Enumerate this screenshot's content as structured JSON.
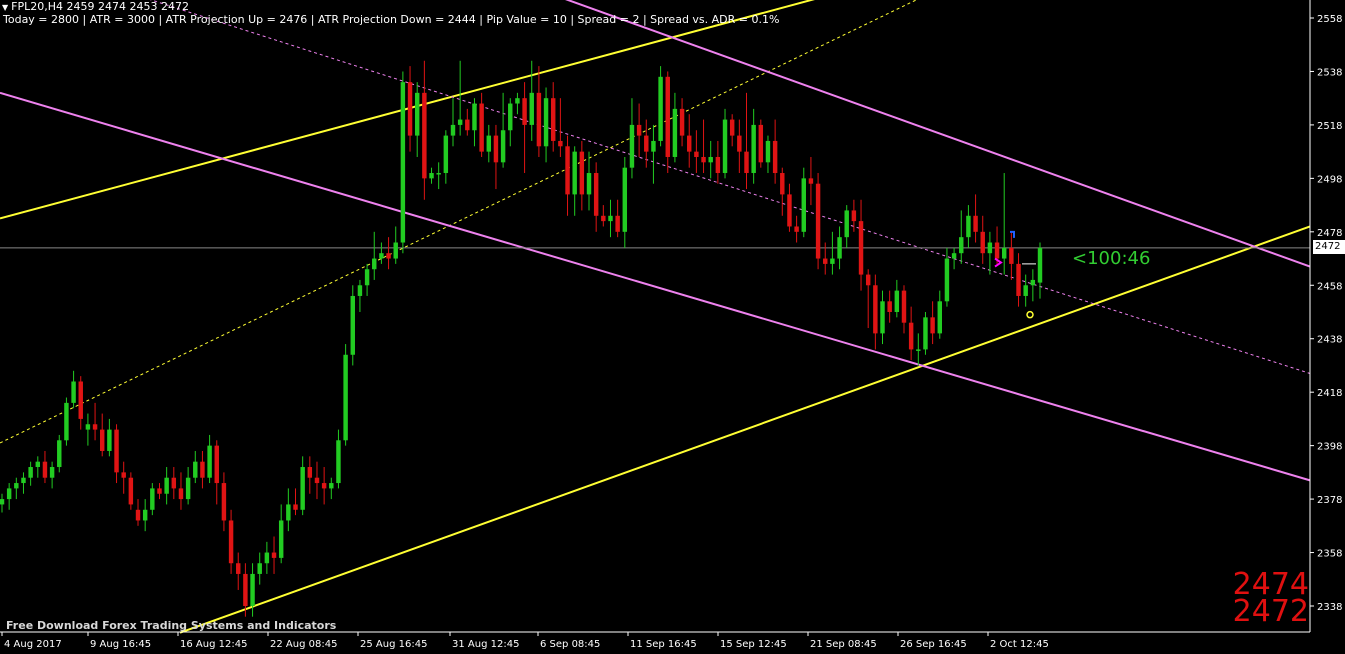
{
  "header": {
    "symbol_line": "FPL20,H4  2459 2474 2453 2472",
    "info_line": "Today = 2800   |   ATR = 3000   |   ATR Projection Up = 2476   |   ATR Projection Down = 2444   |   Pip Value = 10   |   Spread = 2   |   Spread vs. ADR = 0.1%"
  },
  "watermark": "Free Download Forex Trading Systems and Indicators",
  "countdown": "<100:46",
  "big_prices": {
    "high": "2474",
    "current": "2472"
  },
  "current_price_tag": "2472",
  "colors": {
    "background": "#000000",
    "bull": "#22cc22",
    "bear": "#e01414",
    "yellow_channel": "#ffff33",
    "pink_channel": "#ee82ee",
    "axis_text": "#ffffff",
    "countdown": "#32cd32"
  },
  "chart_data": {
    "type": "candlestick",
    "timeframe": "H4",
    "symbol": "FPL20",
    "ylim": [
      2328,
      2564
    ],
    "y_ticks": [
      2558,
      2538,
      2518,
      2498,
      2478,
      2458,
      2438,
      2418,
      2398,
      2378,
      2358,
      2338
    ],
    "x_ticks": [
      "4 Aug 2017",
      "9 Aug 16:45",
      "16 Aug 12:45",
      "22 Aug 08:45",
      "25 Aug 16:45",
      "31 Aug 12:45",
      "6 Sep 08:45",
      "11 Sep 16:45",
      "15 Sep 12:45",
      "21 Sep 08:45",
      "26 Sep 16:45",
      "2 Oct 12:45"
    ],
    "current_price": 2472,
    "candles": [
      [
        2376,
        2380,
        2373,
        2378
      ],
      [
        2378,
        2384,
        2374,
        2382
      ],
      [
        2382,
        2386,
        2378,
        2384
      ],
      [
        2384,
        2388,
        2380,
        2386
      ],
      [
        2386,
        2392,
        2383,
        2390
      ],
      [
        2390,
        2394,
        2386,
        2392
      ],
      [
        2392,
        2396,
        2384,
        2386
      ],
      [
        2386,
        2392,
        2382,
        2390
      ],
      [
        2390,
        2402,
        2388,
        2400
      ],
      [
        2400,
        2416,
        2398,
        2414
      ],
      [
        2414,
        2426,
        2412,
        2422
      ],
      [
        2422,
        2424,
        2404,
        2408
      ],
      [
        2404,
        2410,
        2398,
        2406
      ],
      [
        2406,
        2414,
        2400,
        2404
      ],
      [
        2404,
        2410,
        2394,
        2396
      ],
      [
        2396,
        2408,
        2394,
        2404
      ],
      [
        2404,
        2406,
        2384,
        2388
      ],
      [
        2388,
        2392,
        2380,
        2386
      ],
      [
        2386,
        2388,
        2374,
        2376
      ],
      [
        2374,
        2378,
        2368,
        2370
      ],
      [
        2370,
        2378,
        2366,
        2374
      ],
      [
        2374,
        2384,
        2372,
        2382
      ],
      [
        2382,
        2384,
        2378,
        2380
      ],
      [
        2380,
        2390,
        2376,
        2386
      ],
      [
        2386,
        2390,
        2378,
        2382
      ],
      [
        2382,
        2388,
        2374,
        2378
      ],
      [
        2378,
        2390,
        2376,
        2386
      ],
      [
        2386,
        2396,
        2384,
        2392
      ],
      [
        2392,
        2396,
        2382,
        2386
      ],
      [
        2386,
        2402,
        2384,
        2398
      ],
      [
        2398,
        2400,
        2376,
        2384
      ],
      [
        2384,
        2388,
        2366,
        2370
      ],
      [
        2370,
        2374,
        2350,
        2354
      ],
      [
        2354,
        2358,
        2344,
        2350
      ],
      [
        2350,
        2354,
        2334,
        2338
      ],
      [
        2338,
        2354,
        2334,
        2350
      ],
      [
        2350,
        2358,
        2346,
        2354
      ],
      [
        2354,
        2362,
        2350,
        2358
      ],
      [
        2358,
        2364,
        2350,
        2356
      ],
      [
        2356,
        2376,
        2354,
        2370
      ],
      [
        2370,
        2382,
        2366,
        2376
      ],
      [
        2376,
        2382,
        2372,
        2374
      ],
      [
        2374,
        2394,
        2372,
        2390
      ],
      [
        2390,
        2394,
        2380,
        2386
      ],
      [
        2386,
        2392,
        2378,
        2384
      ],
      [
        2384,
        2390,
        2376,
        2382
      ],
      [
        2382,
        2386,
        2378,
        2384
      ],
      [
        2384,
        2404,
        2382,
        2400
      ],
      [
        2400,
        2436,
        2398,
        2432
      ],
      [
        2432,
        2458,
        2428,
        2454
      ],
      [
        2454,
        2460,
        2448,
        2458
      ],
      [
        2458,
        2466,
        2454,
        2464
      ],
      [
        2464,
        2478,
        2460,
        2468
      ],
      [
        2468,
        2474,
        2466,
        2470
      ],
      [
        2470,
        2476,
        2464,
        2468
      ],
      [
        2468,
        2480,
        2466,
        2474
      ],
      [
        2474,
        2538,
        2470,
        2534
      ],
      [
        2534,
        2540,
        2508,
        2514
      ],
      [
        2514,
        2534,
        2506,
        2530
      ],
      [
        2530,
        2542,
        2490,
        2498
      ],
      [
        2498,
        2502,
        2496,
        2500
      ],
      [
        2500,
        2504,
        2494,
        2500
      ],
      [
        2500,
        2516,
        2496,
        2514
      ],
      [
        2514,
        2528,
        2510,
        2518
      ],
      [
        2518,
        2542,
        2514,
        2520
      ],
      [
        2520,
        2524,
        2514,
        2516
      ],
      [
        2516,
        2528,
        2510,
        2526
      ],
      [
        2526,
        2530,
        2506,
        2508
      ],
      [
        2508,
        2518,
        2504,
        2514
      ],
      [
        2514,
        2518,
        2494,
        2504
      ],
      [
        2504,
        2530,
        2502,
        2516
      ],
      [
        2516,
        2528,
        2510,
        2526
      ],
      [
        2526,
        2530,
        2522,
        2528
      ],
      [
        2528,
        2534,
        2500,
        2518
      ],
      [
        2518,
        2542,
        2512,
        2530
      ],
      [
        2530,
        2540,
        2506,
        2510
      ],
      [
        2510,
        2532,
        2504,
        2528
      ],
      [
        2528,
        2534,
        2508,
        2512
      ],
      [
        2512,
        2528,
        2506,
        2510
      ],
      [
        2510,
        2514,
        2484,
        2492
      ],
      [
        2492,
        2510,
        2484,
        2508
      ],
      [
        2508,
        2512,
        2486,
        2492
      ],
      [
        2492,
        2508,
        2486,
        2500
      ],
      [
        2500,
        2504,
        2478,
        2484
      ],
      [
        2484,
        2488,
        2480,
        2482
      ],
      [
        2482,
        2490,
        2476,
        2484
      ],
      [
        2484,
        2490,
        2476,
        2478
      ],
      [
        2478,
        2506,
        2472,
        2502
      ],
      [
        2502,
        2528,
        2498,
        2518
      ],
      [
        2518,
        2526,
        2506,
        2514
      ],
      [
        2514,
        2520,
        2502,
        2508
      ],
      [
        2508,
        2518,
        2496,
        2512
      ],
      [
        2512,
        2540,
        2510,
        2536
      ],
      [
        2536,
        2538,
        2500,
        2506
      ],
      [
        2506,
        2530,
        2504,
        2524
      ],
      [
        2524,
        2528,
        2510,
        2514
      ],
      [
        2514,
        2522,
        2502,
        2508
      ],
      [
        2508,
        2516,
        2500,
        2506
      ],
      [
        2506,
        2520,
        2500,
        2504
      ],
      [
        2504,
        2512,
        2498,
        2506
      ],
      [
        2506,
        2512,
        2496,
        2500
      ],
      [
        2500,
        2524,
        2498,
        2520
      ],
      [
        2520,
        2522,
        2510,
        2514
      ],
      [
        2514,
        2520,
        2500,
        2508
      ],
      [
        2508,
        2530,
        2494,
        2500
      ],
      [
        2500,
        2524,
        2496,
        2518
      ],
      [
        2518,
        2520,
        2502,
        2504
      ],
      [
        2504,
        2514,
        2500,
        2512
      ],
      [
        2512,
        2520,
        2496,
        2500
      ],
      [
        2500,
        2502,
        2484,
        2492
      ],
      [
        2492,
        2496,
        2478,
        2480
      ],
      [
        2480,
        2484,
        2474,
        2478
      ],
      [
        2478,
        2502,
        2476,
        2498
      ],
      [
        2498,
        2506,
        2488,
        2496
      ],
      [
        2496,
        2500,
        2464,
        2468
      ],
      [
        2468,
        2474,
        2462,
        2466
      ],
      [
        2466,
        2478,
        2462,
        2468
      ],
      [
        2468,
        2480,
        2464,
        2476
      ],
      [
        2476,
        2488,
        2472,
        2486
      ],
      [
        2486,
        2490,
        2478,
        2482
      ],
      [
        2482,
        2490,
        2456,
        2462
      ],
      [
        2462,
        2464,
        2442,
        2458
      ],
      [
        2458,
        2462,
        2434,
        2440
      ],
      [
        2440,
        2456,
        2436,
        2452
      ],
      [
        2452,
        2456,
        2444,
        2448
      ],
      [
        2448,
        2460,
        2446,
        2456
      ],
      [
        2456,
        2458,
        2440,
        2444
      ],
      [
        2444,
        2450,
        2430,
        2434
      ],
      [
        2434,
        2440,
        2428,
        2434
      ],
      [
        2434,
        2448,
        2432,
        2446
      ],
      [
        2446,
        2452,
        2436,
        2440
      ],
      [
        2440,
        2456,
        2438,
        2452
      ],
      [
        2452,
        2472,
        2450,
        2468
      ],
      [
        2468,
        2472,
        2464,
        2470
      ],
      [
        2470,
        2486,
        2466,
        2476
      ],
      [
        2476,
        2488,
        2472,
        2484
      ],
      [
        2484,
        2492,
        2474,
        2478
      ],
      [
        2478,
        2484,
        2466,
        2470
      ],
      [
        2470,
        2478,
        2462,
        2474
      ],
      [
        2474,
        2480,
        2466,
        2468
      ],
      [
        2468,
        2500,
        2462,
        2472
      ],
      [
        2472,
        2478,
        2460,
        2466
      ],
      [
        2466,
        2470,
        2450,
        2454
      ],
      [
        2454,
        2462,
        2450,
        2458
      ],
      [
        2458,
        2464,
        2452,
        2460
      ],
      [
        2459,
        2474,
        2453,
        2472
      ]
    ],
    "lines": [
      {
        "name": "yellow-upper",
        "from": {
          "x": 0,
          "y": 2483
        },
        "to": {
          "x": 1310,
          "y": 2615
        },
        "style": "solid"
      },
      {
        "name": "yellow-lower",
        "from": {
          "x": 180,
          "y": 2328
        },
        "to": {
          "x": 1310,
          "y": 2480
        },
        "style": "solid"
      },
      {
        "name": "yellow-mid",
        "from": {
          "x": 0,
          "y": 2399
        },
        "to": {
          "x": 1310,
          "y": 2636
        },
        "style": "dotted"
      },
      {
        "name": "pink-upper",
        "from": {
          "x": 380,
          "y": 2590
        },
        "to": {
          "x": 1310,
          "y": 2465
        },
        "style": "solid"
      },
      {
        "name": "pink-lower",
        "from": {
          "x": 0,
          "y": 2530
        },
        "to": {
          "x": 1310,
          "y": 2385
        },
        "style": "solid"
      },
      {
        "name": "pink-mid",
        "from": {
          "x": 0,
          "y": 2583
        },
        "to": {
          "x": 1310,
          "y": 2425
        },
        "style": "dotted"
      }
    ]
  }
}
